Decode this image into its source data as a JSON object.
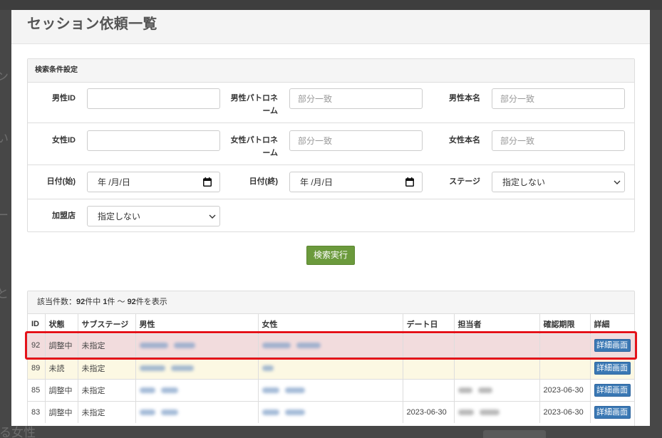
{
  "page_title": "セッション依頼一覧",
  "search": {
    "title": "検索条件設定",
    "fields": {
      "male_id": {
        "label": "男性ID"
      },
      "male_patron": {
        "label": "男性パトロネーム",
        "placeholder": "部分一致"
      },
      "male_name": {
        "label": "男性本名",
        "placeholder": "部分一致"
      },
      "female_id": {
        "label": "女性ID"
      },
      "female_patron": {
        "label": "女性パトロネーム",
        "placeholder": "部分一致"
      },
      "female_name": {
        "label": "女性本名",
        "placeholder": "部分一致"
      },
      "date_from": {
        "label": "日付(始)",
        "display": "年 /月/日"
      },
      "date_to": {
        "label": "日付(終)",
        "display": "年 /月/日"
      },
      "stage": {
        "label": "ステージ",
        "selected": "指定しない"
      },
      "store": {
        "label": "加盟店",
        "selected": "指定しない"
      }
    },
    "submit_label": "検索実行"
  },
  "results": {
    "summary": {
      "label": "該当件数：",
      "total": "92",
      "of_text": "件中 ",
      "from": "1",
      "range_text": "件 ～ ",
      "to": "92",
      "suffix": "件を表示"
    },
    "columns": [
      "ID",
      "状態",
      "サブステージ",
      "男性",
      "女性",
      "デート日",
      "担当者",
      "確認期限",
      "詳細"
    ],
    "rows": [
      {
        "id": "92",
        "status": "調整中",
        "substage": "未指定",
        "detail_label": "詳細画面"
      },
      {
        "id": "89",
        "status": "未読",
        "substage": "未指定",
        "detail_label": "詳細画面"
      },
      {
        "id": "85",
        "status": "調整中",
        "substage": "未指定",
        "deadline": "2023-06-30",
        "detail_label": "詳細画面"
      },
      {
        "id": "83",
        "status": "調整中",
        "substage": "未指定",
        "date": "2023-06-30",
        "deadline": "2023-06-30",
        "detail_label": "詳細画面"
      }
    ]
  },
  "backdrop": {
    "fragments": [
      "ン",
      "い",
      "ー",
      "と"
    ],
    "bottom_text": "る女性"
  },
  "colors": {
    "search_button": "#6b9a3c",
    "detail_button": "#3a78b4",
    "highlight": "#e5121a",
    "row_attention": "#f2dcdd",
    "row_unread": "#fcf8e3"
  }
}
